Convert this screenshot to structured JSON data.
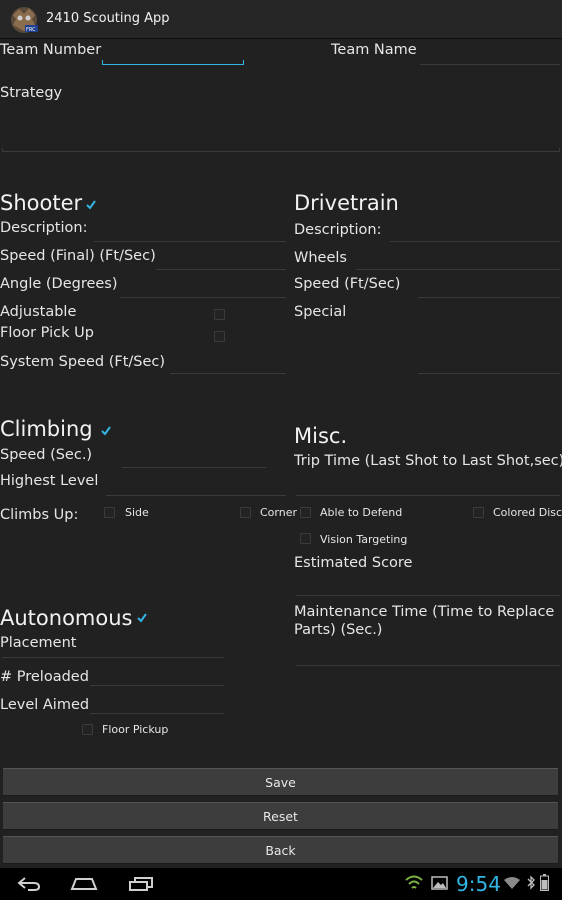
{
  "app": {
    "title": "2410 Scouting App",
    "icon": "robot-logo-icon"
  },
  "form": {
    "team_number": "Team Number",
    "team_name": "Team Name",
    "strategy": "Strategy",
    "shooter": {
      "heading": "Shooter",
      "checked": true,
      "description": "Description:",
      "speed_final": "Speed (Final) (Ft/Sec)",
      "angle": "Angle (Degrees)",
      "adjustable": "Adjustable",
      "floor_pick_up": "Floor Pick Up",
      "system_speed": "System Speed (Ft/Sec)"
    },
    "drivetrain": {
      "heading": "Drivetrain",
      "description": "Description:",
      "wheels": "Wheels",
      "speed": "Speed (Ft/Sec)",
      "special": "Special"
    },
    "climbing": {
      "heading": "Climbing",
      "checked": true,
      "speed": "Speed (Sec.)",
      "highest_level": "Highest Level",
      "climbs_up": "Climbs Up:",
      "side": "Side",
      "corner": "Corner"
    },
    "misc": {
      "heading": "Misc.",
      "trip_time": "Trip Time (Last Shot to Last Shot,sec)",
      "able_to_defend": "Able to Defend",
      "colored_discs": "Colored Discs",
      "vision_targeting": "Vision Targeting",
      "estimated_score": "Estimated Score",
      "maintenance_time_1": "Maintenance Time (Time to Replace",
      "maintenance_time_2": "Parts) (Sec.)"
    },
    "autonomous": {
      "heading": "Autonomous",
      "checked": true,
      "placement": "Placement",
      "preloaded": "# Preloaded",
      "level_aimed": "Level Aimed",
      "floor_pickup": "Floor Pickup"
    }
  },
  "buttons": {
    "save": "Save",
    "reset": "Reset",
    "back": "Back"
  },
  "statusbar": {
    "time": "9:54"
  },
  "colors": {
    "accent": "#33b5e5",
    "background": "#212121",
    "button": "#3d3d3d"
  }
}
